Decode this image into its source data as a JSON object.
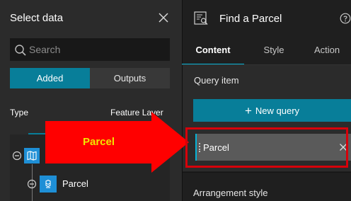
{
  "left_panel": {
    "title": "Select data",
    "close_icon": "close-icon",
    "search": {
      "placeholder": "Search",
      "value": ""
    },
    "segments": {
      "added": "Added",
      "outputs": "Outputs",
      "selected": "added"
    },
    "columns": {
      "type": "Type",
      "feature_layer": "Feature Layer"
    },
    "tree": {
      "map_icon": "map-icon",
      "layer_icon": "feature-layer-icon",
      "item_label": "Parcel"
    }
  },
  "right_panel": {
    "widget_icon": "find-parcel-widget-icon",
    "title": "Find a Parcel",
    "help_icon": "help-icon",
    "tabs": [
      {
        "label": "Content",
        "active": true
      },
      {
        "label": "Style",
        "active": false
      },
      {
        "label": "Action",
        "active": false
      }
    ],
    "query_section": {
      "label": "Query item",
      "new_query_button": "New query",
      "item": "Parcel"
    },
    "arrangement_label": "Arrangement style"
  },
  "annotation": {
    "arrow_label": "Parcel",
    "arrow_color": "#ff0000",
    "label_color": "#f2e600",
    "box_color": "#d6000a"
  },
  "colors": {
    "accent": "#087e99",
    "tab_underline": "#06b3d6",
    "map_icon_bg": "#1e8fd6"
  }
}
